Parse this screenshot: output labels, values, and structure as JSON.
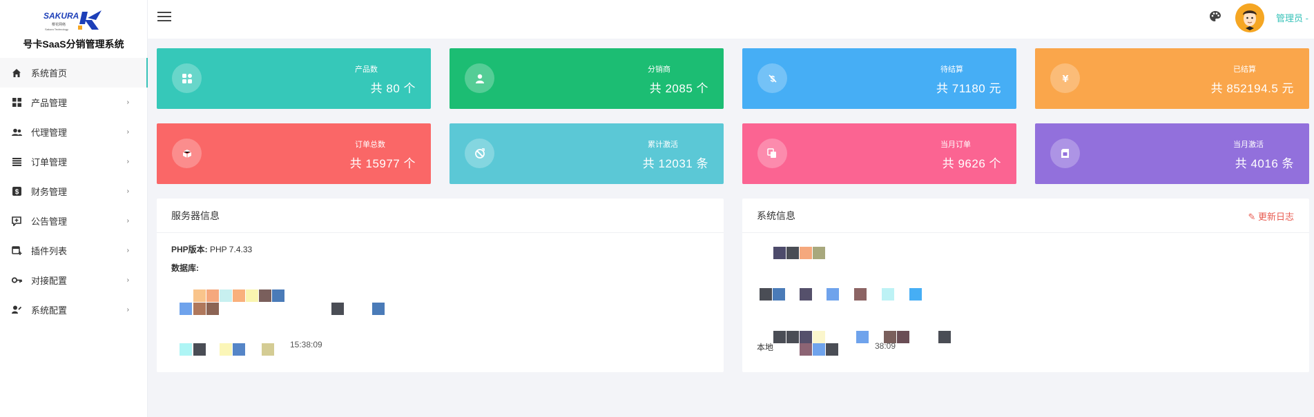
{
  "brand": {
    "logo_text": "SAKURA",
    "logo_sub_cn": "樱花网络",
    "logo_sub_en": "Sakura Technology",
    "title": "号卡SaaS分销管理系统"
  },
  "sidebar": {
    "items": [
      {
        "label": "系统首页",
        "icon": "home-icon",
        "active": true
      },
      {
        "label": "产品管理",
        "icon": "grid-icon",
        "arrow": "›"
      },
      {
        "label": "代理管理",
        "icon": "users-icon",
        "arrow": "›"
      },
      {
        "label": "订单管理",
        "icon": "list-icon",
        "arrow": "›"
      },
      {
        "label": "财务管理",
        "icon": "dollar-icon",
        "arrow": "›"
      },
      {
        "label": "公告管理",
        "icon": "announcement-icon",
        "arrow": "›"
      },
      {
        "label": "插件列表",
        "icon": "plugin-icon",
        "arrow": "›"
      },
      {
        "label": "对接配置",
        "icon": "key-icon",
        "arrow": "›"
      },
      {
        "label": "系统配置",
        "icon": "user-settings-icon",
        "arrow": "›"
      }
    ]
  },
  "header": {
    "admin_name": "管理员 -"
  },
  "stats": [
    {
      "label": "产品数",
      "value": "共 80 个",
      "color": "#36c8b9",
      "icon": "products-icon"
    },
    {
      "label": "分销商",
      "value": "共 2085 个",
      "color": "#1cbd73",
      "icon": "person-icon"
    },
    {
      "label": "待结算",
      "value": "共 71180 元",
      "color": "#46aef5",
      "icon": "pending-icon"
    },
    {
      "label": "已结算",
      "value": "共 852194.5 元",
      "color": "#faa64b",
      "icon": "yen-icon"
    },
    {
      "label": "订单总数",
      "value": "共 15977 个",
      "color": "#fa6767",
      "icon": "box-icon"
    },
    {
      "label": "累计激活",
      "value": "共 12031 条",
      "color": "#5bc8d6",
      "icon": "activate-icon"
    },
    {
      "label": "当月订单",
      "value": "共 9626 个",
      "color": "#fb6492",
      "icon": "copy-icon"
    },
    {
      "label": "当月激活",
      "value": "共 4016 条",
      "color": "#9270dc",
      "icon": "card-icon"
    }
  ],
  "server_panel": {
    "title": "服务器信息",
    "php_label": "PHP版本:",
    "php_value": "PHP 7.4.33",
    "db_label": "数据库:",
    "time_partial": "15:38:09"
  },
  "system_panel": {
    "title": "系统信息",
    "update_log": "更新日志",
    "local_label": "本地",
    "time_partial": "38:09"
  }
}
